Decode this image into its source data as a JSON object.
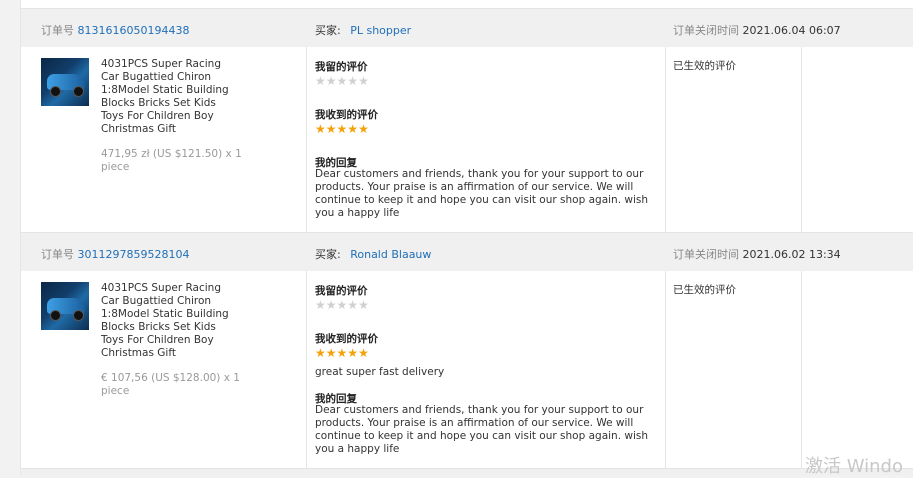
{
  "orders": [
    {
      "order_no_label": "订单号",
      "order_no": "8131616050194438",
      "buyer_label": "买家:",
      "buyer": "PL shopper",
      "close_time_label": "订单关闭时间",
      "close_time": "2021.06.04 06:07",
      "product_title": "4031PCS Super Racing Car Bugattied Chiron 1:8Model Static Building Blocks Bricks Set Kids Toys For Children Boy Christmas Gift",
      "price": "471,95 zł (US $121.50) x 1 piece",
      "my_review_label": "我留的评价",
      "my_review_stars": 0,
      "received_review_label": "我收到的评价",
      "received_review_stars": 5,
      "received_review_text": "",
      "reply_label": "我的回复",
      "reply_text": "Dear customers and friends, thank you for your support to our products. Your praise is an affirmation of our service. We will continue to keep it and hope you can visit our shop again. wish you a happy life",
      "status": "已生效的评价"
    },
    {
      "order_no_label": "订单号",
      "order_no": "3011297859528104",
      "buyer_label": "买家:",
      "buyer": "Ronald Blaauw",
      "close_time_label": "订单关闭时间",
      "close_time": "2021.06.02 13:34",
      "product_title": "4031PCS Super Racing Car Bugattied Chiron 1:8Model Static Building Blocks Bricks Set Kids Toys For Children Boy Christmas Gift",
      "price": "€ 107,56 (US $128.00) x 1 piece",
      "my_review_label": "我留的评价",
      "my_review_stars": 0,
      "received_review_label": "我收到的评价",
      "received_review_stars": 5,
      "received_review_text": "great super fast delivery",
      "reply_label": "我的回复",
      "reply_text": "Dear customers and friends, thank you for your support to our products. Your praise is an affirmation of our service. We will continue to keep it and hope you can visit our shop again. wish you a happy life",
      "status": "已生效的评价"
    }
  ],
  "colors": {
    "link": "#1f6fb8",
    "star_on": "#f5a20a",
    "star_off": "#d0d0d0"
  },
  "watermark": "激活 Windo"
}
